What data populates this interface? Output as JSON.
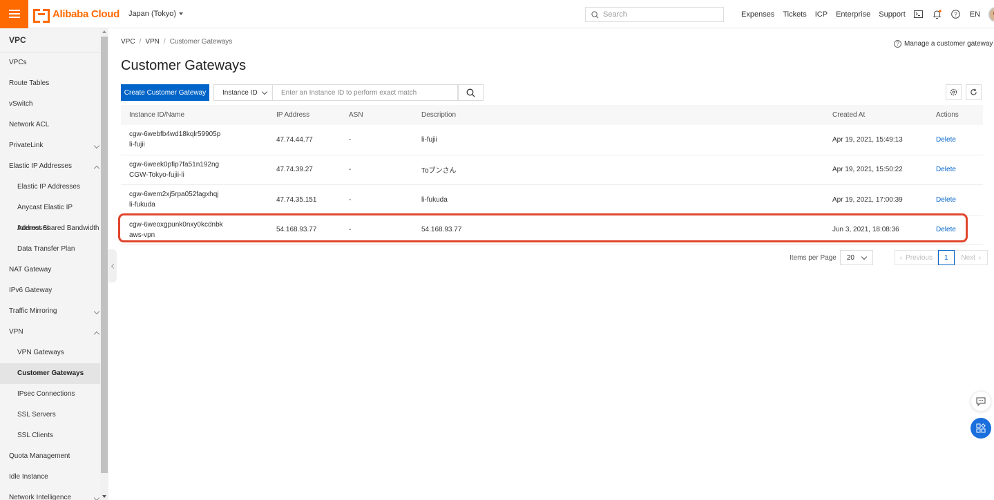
{
  "header": {
    "brand": "Alibaba Cloud",
    "region": "Japan (Tokyo)",
    "search_placeholder": "Search",
    "links": [
      "Expenses",
      "Tickets",
      "ICP",
      "Enterprise",
      "Support"
    ],
    "language": "EN"
  },
  "sidebar": {
    "title": "VPC",
    "items": [
      {
        "label": "VPCs",
        "level": 1
      },
      {
        "label": "Route Tables",
        "level": 1
      },
      {
        "label": "vSwitch",
        "level": 1
      },
      {
        "label": "Network ACL",
        "level": 1
      },
      {
        "label": "PrivateLink",
        "level": 1,
        "chevron": "down"
      },
      {
        "label": "Elastic IP Addresses",
        "level": 1,
        "chevron": "up"
      },
      {
        "label": "Elastic IP Addresses",
        "level": 2
      },
      {
        "label": "Anycast Elastic IP Addresses",
        "level": 2
      },
      {
        "label": "Internet Shared Bandwidth",
        "level": 2
      },
      {
        "label": "Data Transfer Plan",
        "level": 2
      },
      {
        "label": "NAT Gateway",
        "level": 1
      },
      {
        "label": "IPv6 Gateway",
        "level": 1
      },
      {
        "label": "Traffic Mirroring",
        "level": 1,
        "chevron": "down"
      },
      {
        "label": "VPN",
        "level": 1,
        "chevron": "up"
      },
      {
        "label": "VPN Gateways",
        "level": 2
      },
      {
        "label": "Customer Gateways",
        "level": 2,
        "active": true
      },
      {
        "label": "IPsec Connections",
        "level": 2
      },
      {
        "label": "SSL Servers",
        "level": 2
      },
      {
        "label": "SSL Clients",
        "level": 2
      },
      {
        "label": "Quota Management",
        "level": 1
      },
      {
        "label": "Idle Instance",
        "level": 1
      },
      {
        "label": "Network Intelligence",
        "level": 1,
        "chevron": "down"
      }
    ]
  },
  "breadcrumb": [
    "VPC",
    "VPN",
    "Customer Gateways"
  ],
  "help_link": "Manage a customer gateway",
  "page_title": "Customer Gateways",
  "toolbar": {
    "create_label": "Create Customer Gateway",
    "filter_select": "Instance ID",
    "filter_placeholder": "Enter an Instance ID to perform exact match"
  },
  "table": {
    "columns": [
      "Instance ID/Name",
      "IP Address",
      "ASN",
      "Description",
      "Created At",
      "Actions"
    ],
    "rows": [
      {
        "id": "cgw-6webfb4wd18kqlr59905p",
        "name": "li-fujii",
        "ip": "47.74.44.77",
        "asn": "-",
        "description": "li-fujii",
        "created": "Apr 19, 2021, 15:49:13",
        "action": "Delete"
      },
      {
        "id": "cgw-6week0pfip7fa51n192ng",
        "name": "CGW-Tokyo-fujii-li",
        "ip": "47.74.39.27",
        "asn": "-",
        "description": "Toブンさん",
        "created": "Apr 19, 2021, 15:50:22",
        "action": "Delete"
      },
      {
        "id": "cgw-6wem2xj5rpa052fagxhqj",
        "name": "li-fukuda",
        "ip": "47.74.35.151",
        "asn": "-",
        "description": "li-fukuda",
        "created": "Apr 19, 2021, 17:00:39",
        "action": "Delete"
      },
      {
        "id": "cgw-6weoxgpunk0nxy0kcdnbk",
        "name": "aws-vpn",
        "ip": "54.168.93.77",
        "asn": "-",
        "description": "54.168.93.77",
        "created": "Jun 3, 2021, 18:08:36",
        "action": "Delete",
        "highlighted": true
      }
    ]
  },
  "pagination": {
    "items_per_page_label": "Items per Page",
    "per_page": "20",
    "previous": "Previous",
    "current": "1",
    "next": "Next"
  },
  "colors": {
    "brand": "#ff6a00",
    "primary": "#0064c8",
    "highlight": "#e0452c"
  }
}
